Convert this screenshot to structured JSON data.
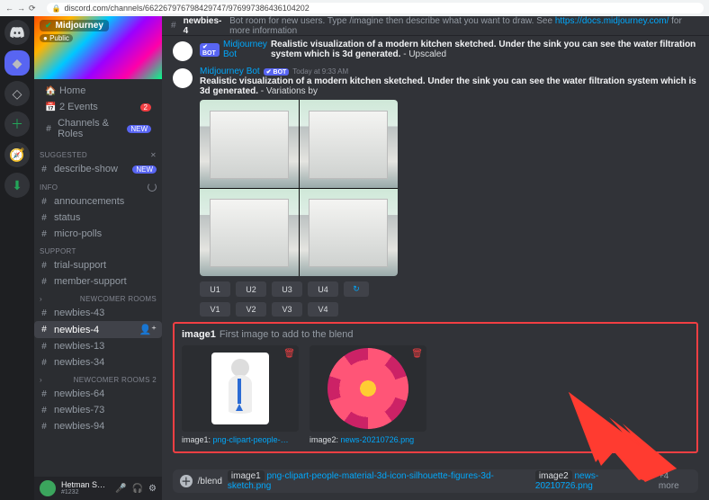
{
  "browser": {
    "url": "discord.com/channels/662267976798429747/976997386436104202"
  },
  "server_rail": {
    "items": [
      "discord",
      "midjourney",
      "mj2",
      "add",
      "explore",
      "download"
    ]
  },
  "server": {
    "name": "Midjourney",
    "public_label": "Public"
  },
  "sidebar": {
    "top": [
      {
        "icon": "🏠",
        "label": "Home"
      },
      {
        "icon": "📅",
        "label": "2 Events",
        "badge": "2"
      },
      {
        "icon": "#",
        "label": "Channels & Roles",
        "new": "NEW"
      }
    ],
    "suggested_title": "SUGGESTED",
    "suggested": [
      {
        "icon": "#",
        "label": "describe-show",
        "new": "NEW"
      }
    ],
    "info_title": "INFO",
    "info": [
      {
        "icon": "#",
        "label": "announcements"
      },
      {
        "icon": "#",
        "label": "status"
      },
      {
        "icon": "#",
        "label": "micro-polls"
      }
    ],
    "support_title": "SUPPORT",
    "support": [
      {
        "icon": "#",
        "label": "trial-support"
      },
      {
        "icon": "#",
        "label": "member-support"
      }
    ],
    "rooms1_title": "NEWCOMER ROOMS",
    "rooms1": [
      {
        "label": "newbies-43"
      },
      {
        "label": "newbies-4",
        "active": true
      },
      {
        "label": "newbies-13"
      },
      {
        "label": "newbies-34"
      }
    ],
    "rooms2_title": "NEWCOMER ROOMS 2",
    "rooms2": [
      {
        "label": "newbies-64"
      },
      {
        "label": "newbies-73"
      },
      {
        "label": "newbies-94"
      }
    ]
  },
  "header": {
    "hash": "#",
    "name": "newbies-4",
    "topic_pre": "Bot room for new users. Type /imagine then describe what you want to draw. See ",
    "topic_link": "https://docs.midjourney.com/",
    "topic_post": " for more information"
  },
  "messages": {
    "old": {
      "author": "Midjourney Bot",
      "bot": "✔ BOT",
      "text_b": "Realistic visualization of a modern kitchen sketched. Under the sink you can see the water filtration system which is 3d generated.",
      "text_after": " - Upscaled"
    },
    "main": {
      "author": "Midjourney Bot",
      "bot": "✔ BOT",
      "ts": "Today at 9:33 AM",
      "text_b": "Realistic visualization of a modern kitchen sketched. Under the sink you can see the water filtration system which is 3d generated.",
      "text_after": " - Variations by",
      "u": [
        "U1",
        "U2",
        "U3",
        "U4"
      ],
      "v": [
        "V1",
        "V2",
        "V3",
        "V4"
      ],
      "reroll": "↻"
    }
  },
  "attach": {
    "title": "image1",
    "subtitle": "First image to add to the blend",
    "cards": [
      {
        "key": "image1:",
        "file": "png-clipart-people-…"
      },
      {
        "key": "image2:",
        "file": "news-20210726.png"
      }
    ],
    "trash": "🗑"
  },
  "composer": {
    "cmd": "/blend",
    "params": [
      {
        "k": "image1",
        "v": "png-clipart-people-material-3d-icon-silhouette-figures-3d-sketch.png"
      },
      {
        "k": "image2",
        "v": "news-20210726.png"
      }
    ],
    "more": "+4 more"
  },
  "user_footer": {
    "name": "Hetman S…",
    "tag": "#1232"
  }
}
